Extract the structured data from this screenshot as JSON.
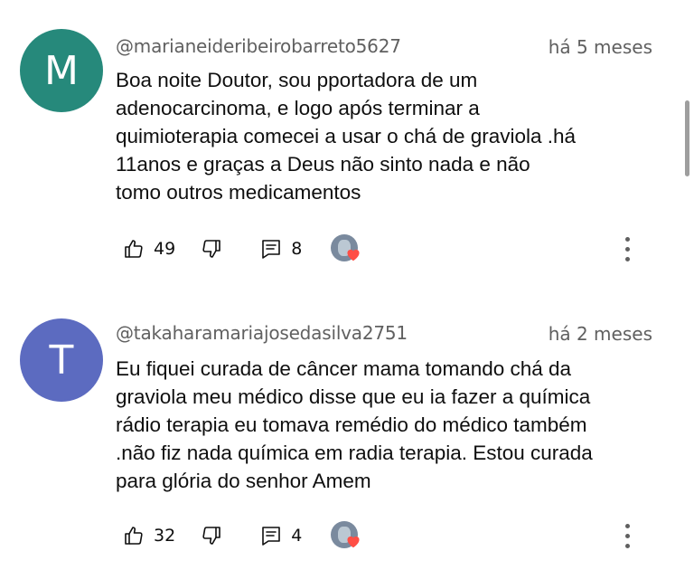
{
  "comments": [
    {
      "avatar_letter": "M",
      "avatar_color": "#26897b",
      "author": "@marianeideribeirobarreto5627",
      "time": "há 5 meses",
      "text": "Boa noite  Doutor, sou pportadora de um\nadenocarcinoma, e logo após   terminar a\nquimioterapia  comecei a usar o chá de  graviola .há\n11anos e graças a Deus  não  sinto nada e não\ntomo  outros  medicamentos",
      "likes": "49",
      "replies": "8"
    },
    {
      "avatar_letter": "T",
      "avatar_color": "#5c6bc0",
      "author": "@takaharamariajosedasilva2751",
      "time": "há 2 meses",
      "text": "Eu fiquei curada de câncer mama tomando chá da\ngraviola meu médico disse que eu ia fazer a química\nrádio terapia eu tomava remédio do médico também\n.não fiz nada química em radia terapia. Estou curada\npara glória do senhor Amem",
      "likes": "32",
      "replies": "4"
    }
  ],
  "icons": {
    "like": "thumb-up-icon",
    "dislike": "thumb-down-icon",
    "reply": "comment-icon",
    "creator_heart": "creator-heart-icon",
    "more": "more-vert-icon"
  },
  "colors": {
    "heart": "#ff4e45",
    "secondary_text": "#606060"
  }
}
